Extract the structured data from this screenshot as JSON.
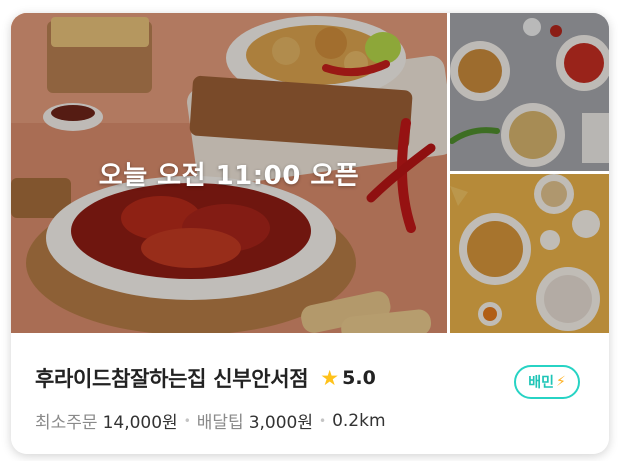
{
  "store": {
    "overlay_text": "오늘 오전 11:00 오픈",
    "name": "후라이드참잘하는집 신부안서점",
    "rating": "5.0",
    "star_icon": "star-icon",
    "badge_label": "배민",
    "badge_icon": "rider-icon"
  },
  "meta": {
    "min_order_label": "최소주문",
    "min_order_value": "14,000원",
    "delivery_tip_label": "배달팁",
    "delivery_tip_value": "3,000원",
    "distance": "0.2km"
  },
  "colors": {
    "badge": "#27d3c4",
    "star": "#ffc21a",
    "main_bg": "#d98c6c",
    "side_top_bg": "#9fa1a6",
    "side_bottom_bg": "#e9b24a"
  }
}
